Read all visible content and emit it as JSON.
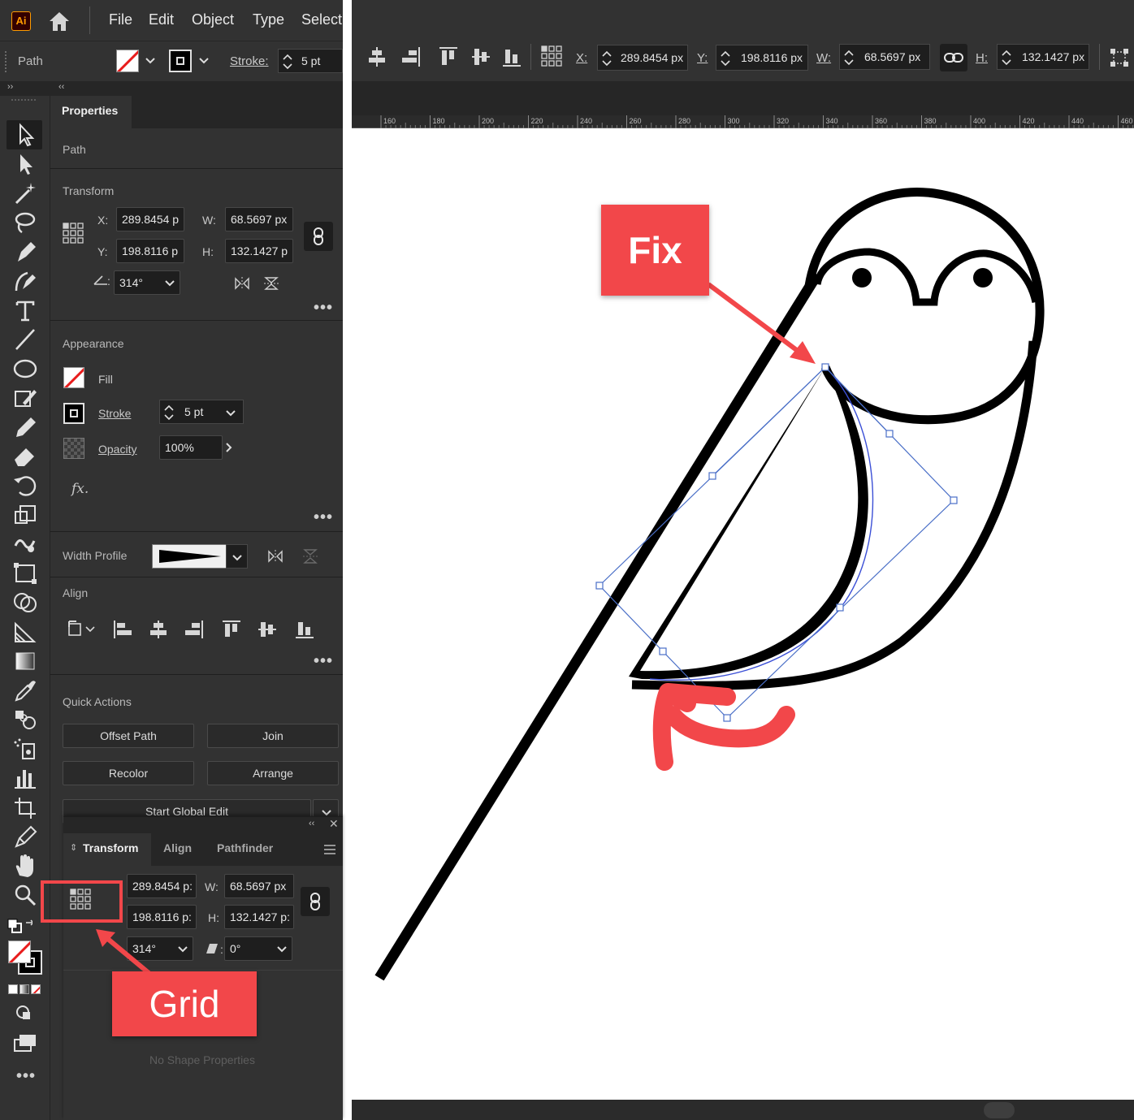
{
  "app": {
    "logo": "Ai"
  },
  "menu": [
    "File",
    "Edit",
    "Object",
    "Type",
    "Select"
  ],
  "control_bar": {
    "selection": "Path",
    "stroke_label": "Stroke:",
    "stroke_value": "5 pt",
    "x_label": "X:",
    "x_value": "289.8454 px",
    "y_label": "Y:",
    "y_value": "198.8116 px",
    "w_label": "W:",
    "w_value": "68.5697 px",
    "h_label": "H:",
    "h_value": "132.1427 px"
  },
  "properties": {
    "tab": "Properties",
    "object_type": "Path",
    "transform": {
      "title": "Transform",
      "x_label": "X:",
      "x": "289.8454 p",
      "y_label": "Y:",
      "y": "198.8116 p",
      "w_label": "W:",
      "w": "68.5697 px",
      "h_label": "H:",
      "h": "132.1427 p",
      "angle": "314°"
    },
    "appearance": {
      "title": "Appearance",
      "fill_label": "Fill",
      "stroke_label": "Stroke",
      "stroke_value": "5 pt",
      "opacity_label": "Opacity",
      "opacity_value": "100%",
      "fx": "fx."
    },
    "width_profile_label": "Width Profile",
    "align_title": "Align",
    "quick_actions": {
      "title": "Quick Actions",
      "buttons": [
        "Offset Path",
        "Join",
        "Recolor",
        "Arrange"
      ],
      "global_edit": "Start Global Edit"
    }
  },
  "transform_panel": {
    "tabs": [
      "Transform",
      "Align",
      "Pathfinder"
    ],
    "x": "289.8454 p:",
    "y": "198.8116 p:",
    "w_label": "W:",
    "w": "68.5697 px",
    "h_label": "H:",
    "h": "132.1427 p:",
    "angle": "314°",
    "shear_label": ":",
    "shear": "0°",
    "empty_note": "No Shape Properties"
  },
  "ruler": [
    "160",
    "180",
    "200",
    "220",
    "240",
    "260",
    "280",
    "300",
    "320",
    "340",
    "360",
    "380",
    "400",
    "420",
    "440",
    "460"
  ],
  "annotations": {
    "fix": "Fix",
    "grid": "Grid"
  },
  "colors": {
    "accent_red": "#f2474a",
    "selection_blue": "#4a6fc7",
    "panel": "#323232"
  }
}
